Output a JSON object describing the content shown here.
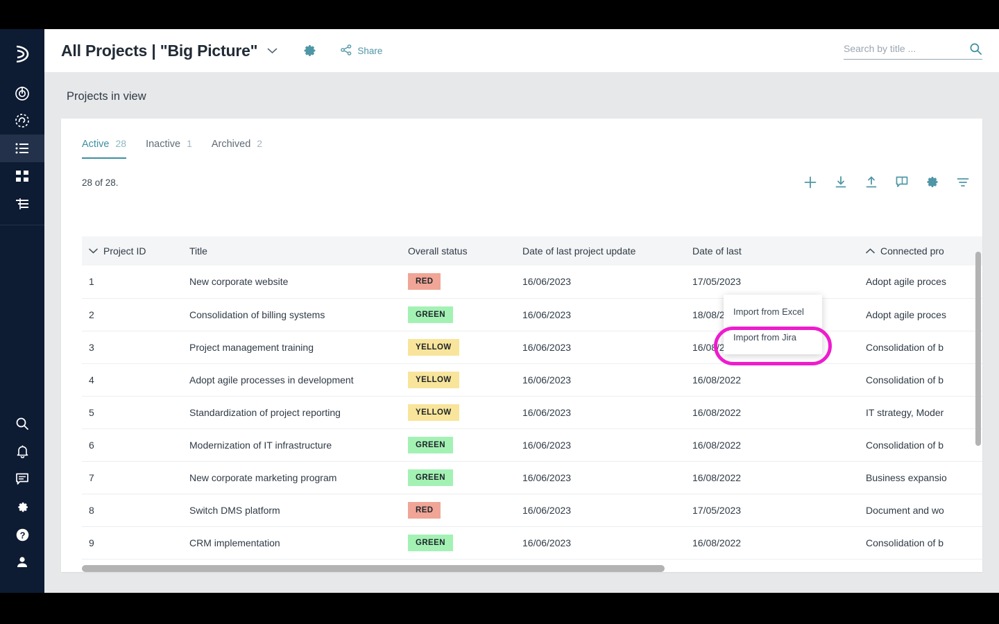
{
  "sidebar": {
    "top_items": [
      {
        "name": "logo",
        "icon": "moon-arc-logo-icon",
        "active": false
      },
      {
        "name": "strategy",
        "icon": "target-icon",
        "active": false
      },
      {
        "name": "roadmap",
        "icon": "dashed-circle-icon",
        "active": false
      },
      {
        "name": "projects",
        "icon": "list-icon",
        "active": true
      },
      {
        "name": "portfolio",
        "icon": "grid-icon",
        "active": false
      },
      {
        "name": "reports",
        "icon": "align-lines-icon",
        "active": false
      }
    ],
    "bottom_items": [
      {
        "name": "search",
        "icon": "search-icon"
      },
      {
        "name": "notifications",
        "icon": "bell-icon"
      },
      {
        "name": "messages",
        "icon": "chat-icon"
      },
      {
        "name": "settings",
        "icon": "gear-icon"
      },
      {
        "name": "help",
        "icon": "question-circle-icon"
      },
      {
        "name": "account",
        "icon": "person-icon"
      }
    ]
  },
  "header": {
    "title": "All Projects | \"Big Picture\"",
    "chevron_icon": "chevron-down-icon",
    "gear_icon": "gear-icon",
    "share_icon": "share-icon",
    "share_label": "Share"
  },
  "search": {
    "placeholder": "Search by title ...",
    "value": "",
    "icon": "search-icon"
  },
  "page": {
    "section_title": "Projects in view"
  },
  "tabs": [
    {
      "label": "Active",
      "count": "28",
      "selected": true
    },
    {
      "label": "Inactive",
      "count": "1",
      "selected": false
    },
    {
      "label": "Archived",
      "count": "2",
      "selected": false
    }
  ],
  "toolbar": {
    "count_label": "28 of 28.",
    "icons": [
      {
        "name": "add-project-button",
        "icon": "plus-icon"
      },
      {
        "name": "import-button",
        "icon": "download-icon"
      },
      {
        "name": "export-button",
        "icon": "upload-icon"
      },
      {
        "name": "comments-button",
        "icon": "comment-icon"
      },
      {
        "name": "table-settings-button",
        "icon": "gear-icon"
      },
      {
        "name": "filter-button",
        "icon": "filter-icon"
      }
    ]
  },
  "dropdown": {
    "items": [
      {
        "label": "Import from Excel",
        "highlighted": false
      },
      {
        "label": "Import from Jira",
        "highlighted": true
      }
    ],
    "highlight_color": "#ee1ccd"
  },
  "table": {
    "columns": [
      {
        "key": "id",
        "label": "Project ID",
        "sort_icon": "chevron-down-icon"
      },
      {
        "key": "title",
        "label": "Title",
        "sort_icon": ""
      },
      {
        "key": "status",
        "label": "Overall status",
        "sort_icon": ""
      },
      {
        "key": "date_update",
        "label": "Date of last project update",
        "sort_icon": ""
      },
      {
        "key": "date_last",
        "label": "Date of last",
        "sort_icon": ""
      },
      {
        "key": "connected",
        "label": "Connected pro",
        "sort_icon": "chevron-up-icon"
      }
    ],
    "rows": [
      {
        "id": "1",
        "title": "New corporate website",
        "status": "RED",
        "date_update": "16/06/2023",
        "date_last": "17/05/2023",
        "connected": "Adopt agile proces"
      },
      {
        "id": "2",
        "title": "Consolidation of billing systems",
        "status": "GREEN",
        "date_update": "16/06/2023",
        "date_last": "18/08/2022",
        "connected": "Adopt agile proces"
      },
      {
        "id": "3",
        "title": "Project management training",
        "status": "YELLOW",
        "date_update": "16/06/2023",
        "date_last": "16/08/2022",
        "connected": "Consolidation of b"
      },
      {
        "id": "4",
        "title": "Adopt agile processes in development",
        "status": "YELLOW",
        "date_update": "16/06/2023",
        "date_last": "16/08/2022",
        "connected": "Consolidation of b"
      },
      {
        "id": "5",
        "title": "Standardization of project reporting",
        "status": "YELLOW",
        "date_update": "16/06/2023",
        "date_last": "16/08/2022",
        "connected": "IT strategy, Moder"
      },
      {
        "id": "6",
        "title": "Modernization of IT infrastructure",
        "status": "GREEN",
        "date_update": "16/06/2023",
        "date_last": "16/08/2022",
        "connected": "Consolidation of b"
      },
      {
        "id": "7",
        "title": "New corporate marketing program",
        "status": "GREEN",
        "date_update": "16/06/2023",
        "date_last": "16/08/2022",
        "connected": "Business expansio"
      },
      {
        "id": "8",
        "title": "Switch DMS platform",
        "status": "RED",
        "date_update": "16/06/2023",
        "date_last": "17/05/2023",
        "connected": "Document and wo"
      },
      {
        "id": "9",
        "title": "CRM implementation",
        "status": "GREEN",
        "date_update": "16/06/2023",
        "date_last": "16/08/2022",
        "connected": "Consolidation of b"
      }
    ]
  },
  "colors": {
    "accent_teal": "#4f96a6",
    "sidebar_navy": "#0d1b33",
    "status_red": "#f0a596",
    "status_green": "#a3f2b4",
    "status_yellow": "#f8e59b",
    "highlight_magenta": "#ee1ccd"
  }
}
